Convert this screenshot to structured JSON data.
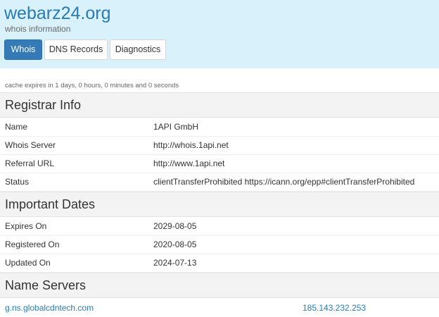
{
  "site": {
    "title": "webarz24.org",
    "subtitle": "whois information"
  },
  "tabs": {
    "whois": "Whois",
    "dns": "DNS Records",
    "diagnostics": "Diagnostics"
  },
  "cache_note": "cache expires in 1 days, 0 hours, 0 minutes and 0 seconds",
  "registrar": {
    "heading": "Registrar Info",
    "rows": [
      {
        "label": "Name",
        "value": "1API GmbH"
      },
      {
        "label": "Whois Server",
        "value": "http://whois.1api.net"
      },
      {
        "label": "Referral URL",
        "value": "http://www.1api.net"
      },
      {
        "label": "Status",
        "value": "clientTransferProhibited https://icann.org/epp#clientTransferProhibited"
      }
    ]
  },
  "dates": {
    "heading": "Important Dates",
    "rows": [
      {
        "label": "Expires On",
        "value": "2029-08-05"
      },
      {
        "label": "Registered On",
        "value": "2020-08-05"
      },
      {
        "label": "Updated On",
        "value": "2024-07-13"
      }
    ]
  },
  "nameservers": {
    "heading": "Name Servers",
    "rows": [
      {
        "name": "g.ns.globalcdntech.com",
        "ip": "185.143.232.253"
      }
    ]
  }
}
